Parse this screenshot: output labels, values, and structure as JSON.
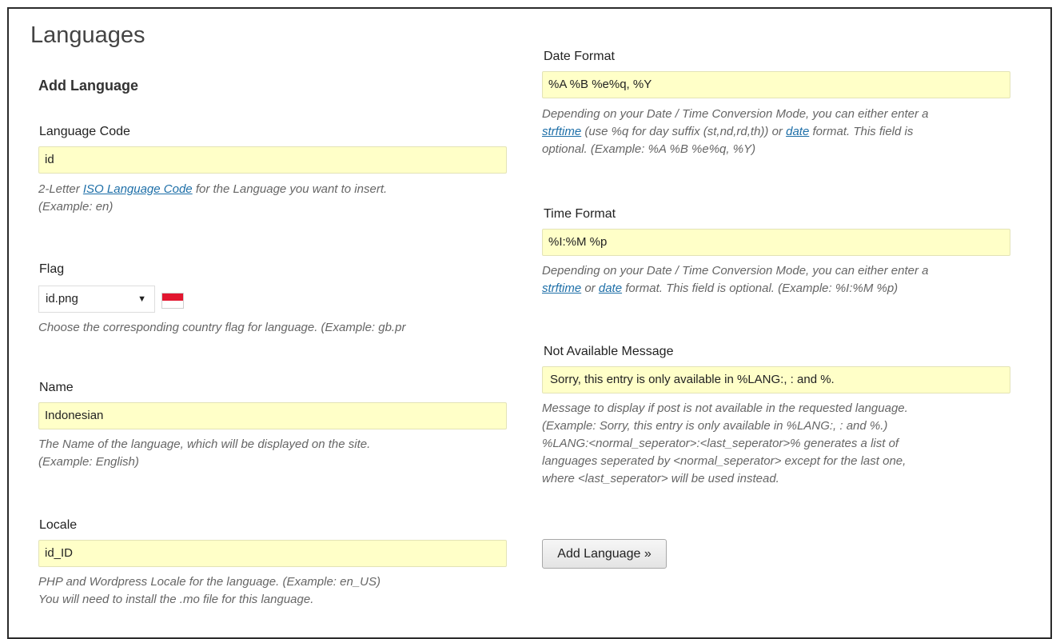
{
  "page": {
    "title": "Languages",
    "section_heading": "Add Language"
  },
  "form": {
    "language_code": {
      "label": "Language Code",
      "value": "id",
      "help_prefix": "2-Letter ",
      "help_link": "ISO Language Code",
      "help_suffix": " for the Language you want to insert.",
      "help_line2": "(Example: en)"
    },
    "flag": {
      "label": "Flag",
      "selected": "id.png",
      "flag_colors": [
        "#e2162f",
        "#ffffff"
      ],
      "help": "Choose the corresponding country flag for language. (Example: gb.pr"
    },
    "name": {
      "label": "Name",
      "value": "Indonesian",
      "help_line1": "The Name of the language, which will be displayed on the site.",
      "help_line2": "(Example: English)"
    },
    "locale": {
      "label": "Locale",
      "value": "id_ID",
      "help_line1": "PHP and Wordpress Locale for the language. (Example: en_US)",
      "help_line2": "You will need to install the .mo file for this language."
    },
    "date_format": {
      "label": "Date Format",
      "value": "%A %B %e%q, %Y",
      "help_line1": "Depending on your Date / Time Conversion Mode, you can either enter a",
      "help_link1": "strftime",
      "help_mid": " (use %q for day suffix (st,nd,rd,th)) or ",
      "help_link2": "date",
      "help_end": " format. This field is",
      "help_line3": "optional. (Example: %A %B %e%q, %Y)"
    },
    "time_format": {
      "label": "Time Format",
      "value": "%I:%M %p",
      "help_line1": "Depending on your Date / Time Conversion Mode, you can either enter a",
      "help_link1": "strftime",
      "help_mid": " or ",
      "help_link2": "date",
      "help_end": " format. This field is optional. (Example: %I:%M %p)"
    },
    "not_available": {
      "label": "Not Available Message",
      "value": "Sorry, this entry is only available in %LANG:, : and %.",
      "help_lines": [
        "Message to display if post is not available in the requested language.",
        "(Example: Sorry, this entry is only available in %LANG:, : and %.)",
        "%LANG:<normal_seperator>:<last_seperator>% generates a list of",
        "languages seperated by <normal_seperator> except for the last one,",
        "where <last_seperator> will be used instead."
      ]
    },
    "submit_label": "Add Language »"
  },
  "colors": {
    "input_bg": "#ffffc8",
    "link": "#1e6fa8"
  }
}
